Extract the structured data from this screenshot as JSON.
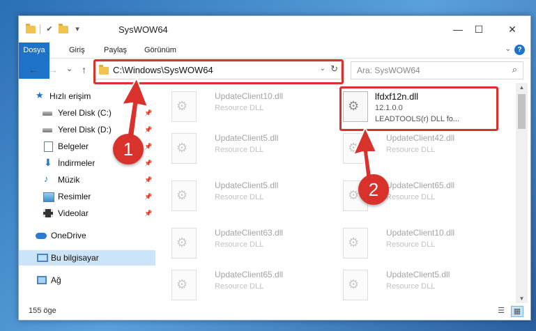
{
  "window": {
    "title": "SysWOW64",
    "controls": {
      "minimize": "—",
      "maximize": "☐",
      "close": "✕"
    }
  },
  "ribbon": {
    "tabs": [
      "Dosya",
      "Giriş",
      "Paylaş",
      "Görünüm"
    ],
    "expand_icon": "chevron-down-icon",
    "help": "?"
  },
  "navbar": {
    "back": "←",
    "forward": "→",
    "recent": "⌄",
    "up": "↑",
    "address": "C:\\Windows\\SysWOW64",
    "search_placeholder": "Ara: SysWOW64",
    "refresh": "↻"
  },
  "nav_pane": {
    "items": [
      {
        "label": "Hızlı erişim",
        "icon": "star-icon",
        "pinned": false
      },
      {
        "label": "Yerel Disk (C:)",
        "icon": "drive-icon",
        "pinned": true
      },
      {
        "label": "Yerel Disk (D:)",
        "icon": "drive-icon",
        "pinned": true
      },
      {
        "label": "Belgeler",
        "icon": "documents-icon",
        "pinned": true
      },
      {
        "label": "İndirmeler",
        "icon": "downloads-icon",
        "pinned": true
      },
      {
        "label": "Müzik",
        "icon": "music-icon",
        "pinned": true
      },
      {
        "label": "Resimler",
        "icon": "pictures-icon",
        "pinned": true
      },
      {
        "label": "Videolar",
        "icon": "videos-icon",
        "pinned": true
      },
      {
        "label": "OneDrive",
        "icon": "onedrive-icon",
        "pinned": false
      },
      {
        "label": "Bu bilgisayar",
        "icon": "this-pc-icon",
        "pinned": false,
        "selected": true
      },
      {
        "label": "Ağ",
        "icon": "network-icon",
        "pinned": false
      }
    ]
  },
  "files": {
    "left_column": [
      {
        "name": "UpdateClient10.dll",
        "type": "Resource DLL"
      },
      {
        "name": "UpdateClient5.dll",
        "type": "Resource DLL"
      },
      {
        "name": "UpdateClient5.dll",
        "type": "Resource DLL"
      },
      {
        "name": "UpdateClient63.dll",
        "type": "Resource DLL"
      },
      {
        "name": "UpdateClient65.dll",
        "type": "Resource DLL"
      }
    ],
    "highlighted": {
      "name": "lfdxf12n.dll",
      "version": "12.1.0.0",
      "description": "LEADTOOLS(r) DLL fo..."
    },
    "right_column": [
      {
        "name": "UpdateClient42.dll",
        "type": "Resource DLL"
      },
      {
        "name": "UpdateClient65.dll",
        "type": "Resource DLL"
      },
      {
        "name": "UpdateClient10.dll",
        "type": "Resource DLL"
      },
      {
        "name": "UpdateClient5.dll",
        "type": "Resource DLL"
      }
    ]
  },
  "status": {
    "count": "155 öge"
  },
  "annotations": {
    "step1": "1",
    "step2": "2",
    "color": "#d9322d"
  }
}
